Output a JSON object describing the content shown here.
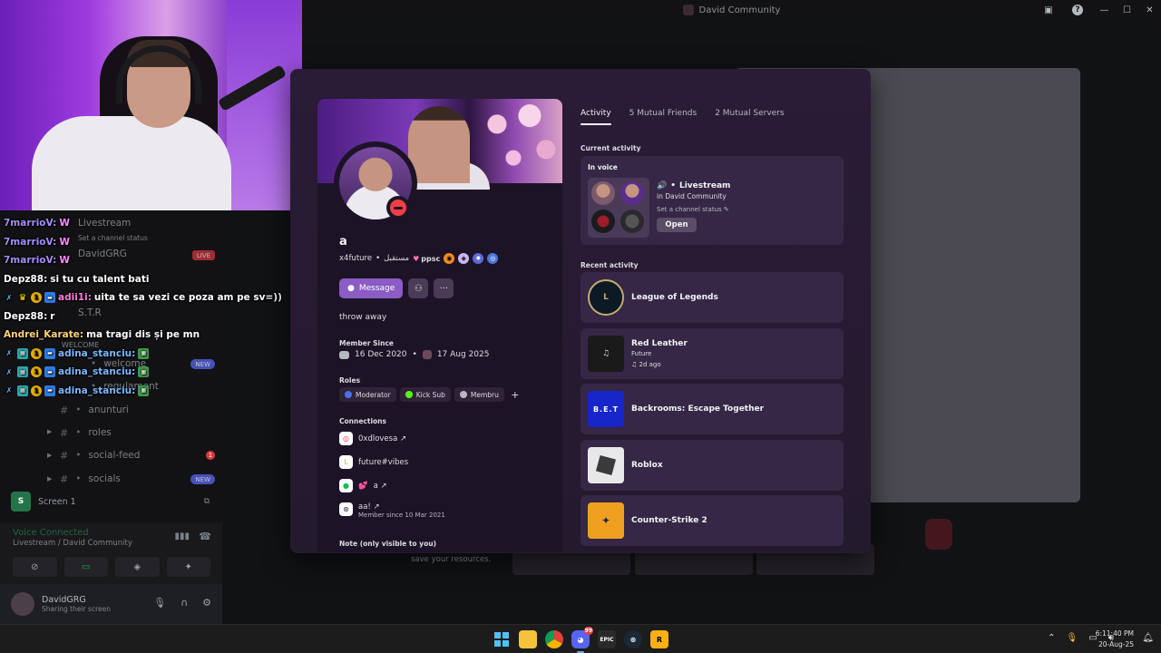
{
  "window": {
    "title": "David Community"
  },
  "sidebar": {
    "voice_channel": "Livestream",
    "set_status": "Set a channel status",
    "members": [
      {
        "name": "DavidGRG",
        "badge": "LIVE"
      },
      {
        "name": "S.T.R"
      }
    ],
    "category": "WELCOME",
    "channels": [
      {
        "name": "welcome",
        "badge": "NEW"
      },
      {
        "name": "regulament"
      },
      {
        "name": "anunturi"
      },
      {
        "name": "roles"
      },
      {
        "name": "social-feed",
        "badge": "1"
      },
      {
        "name": "socials",
        "badge": "NEW"
      }
    ],
    "screen_share": {
      "avatar_letter": "S",
      "label": "Screen 1"
    },
    "voice_connected": "Voice Connected",
    "voice_location": "Livestream / David Community",
    "user": {
      "name": "DavidGRG",
      "status": "Sharing their screen"
    }
  },
  "chat": [
    {
      "nick": "7marrioV",
      "nick_color": "#a78bfa",
      "msg": "W",
      "msg_color": "#ff8cff"
    },
    {
      "nick": "7marrioV",
      "nick_color": "#a78bfa",
      "msg": "W",
      "msg_color": "#ff8cff"
    },
    {
      "nick": "7marrioV",
      "nick_color": "#a78bfa",
      "msg": "W",
      "msg_color": "#ff8cff"
    },
    {
      "nick": "Depz88",
      "nick_color": "#ffffff",
      "msg": "si tu cu talent bati",
      "msg_color": "#ffffff"
    },
    {
      "nick": "adii1i",
      "nick_color": "#ff7ad9",
      "msg": "uita te sa vezi ce poza am pe sv=))",
      "msg_color": "#ffffff"
    },
    {
      "nick": "Depz88",
      "nick_color": "#ffffff",
      "msg": "r",
      "msg_color": "#ffffff"
    },
    {
      "nick": "Andrei_Karate",
      "nick_color": "#ffd27a",
      "msg": "ma tragi dis și pe mn",
      "msg_color": "#ffffff"
    },
    {
      "nick": "adina_stanciu",
      "nick_color": "#7ab8ff",
      "msg": "",
      "msg_color": "#ffffff"
    },
    {
      "nick": "adina_stanciu",
      "nick_color": "#7ab8ff",
      "msg": "",
      "msg_color": "#ffffff"
    },
    {
      "nick": "adina_stanciu",
      "nick_color": "#7ab8ff",
      "msg": "",
      "msg_color": "#ffffff"
    }
  ],
  "background": {
    "save_text": "save your resources."
  },
  "profile": {
    "display_name": "a",
    "username": "x4future",
    "arabic_tag": "مستقبل",
    "clan_tag": "ppsc",
    "message_button": "Message",
    "bio": "throw away",
    "member_since_label": "Member Since",
    "discord_date": "16 Dec 2020",
    "server_date": "17 Aug 2025",
    "roles_label": "Roles",
    "roles": [
      {
        "name": "Moderator",
        "color": "#4e6ef2"
      },
      {
        "name": "Kick Sub",
        "color": "#53fc18"
      },
      {
        "name": "Membru",
        "color": "#b5bac1"
      }
    ],
    "connections_label": "Connections",
    "connections": [
      {
        "name": "0xdlovesa ↗",
        "icon": "instagram-icon",
        "color": "#e1306c"
      },
      {
        "name": "future#vibes",
        "icon": "league-icon",
        "color": "#c8aa6e"
      },
      {
        "name": "a ↗",
        "icon": "spotify-icon",
        "color": "#1db954"
      },
      {
        "name": "aa! ↗",
        "icon": "steam-icon",
        "color": "#ffffff",
        "sub": "Member since 10 Mar 2021"
      }
    ],
    "note_label": "Note (only visible to you)"
  },
  "tabs": [
    {
      "label": "Activity",
      "active": true
    },
    {
      "label": "5 Mutual Friends",
      "active": false
    },
    {
      "label": "2 Mutual Servers",
      "active": false
    }
  ],
  "current_activity": {
    "heading": "Current activity",
    "label": "In voice",
    "channel": "Livestream",
    "server": "in David Community",
    "status_prompt": "Set a channel status",
    "open_button": "Open"
  },
  "recent_activity": {
    "heading": "Recent activity",
    "items": [
      {
        "name": "League of Legends",
        "sub": "",
        "time": ""
      },
      {
        "name": "Red Leather",
        "sub": "Future",
        "time": "2d ago"
      },
      {
        "name": "Backrooms: Escape Together",
        "sub": "",
        "time": ""
      },
      {
        "name": "Roblox",
        "sub": "",
        "time": ""
      },
      {
        "name": "Counter-Strike 2",
        "sub": "",
        "time": ""
      }
    ]
  },
  "taskbar": {
    "time": "6:11:40 PM",
    "date": "20-Aug-25",
    "discord_notifications": "99"
  }
}
